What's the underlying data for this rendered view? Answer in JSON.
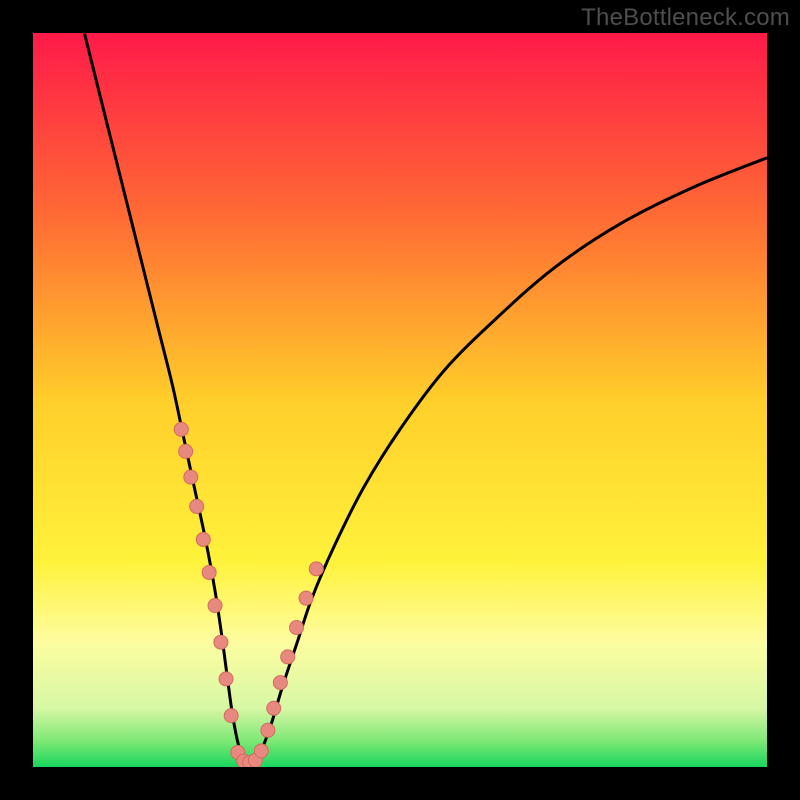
{
  "watermark": "TheBottleneck.com",
  "colors": {
    "black": "#000000",
    "dot_fill": "#e8897f",
    "dot_stroke": "#d46a5f",
    "curve": "#000000"
  },
  "chart_data": {
    "type": "line",
    "title": "",
    "xlabel": "",
    "ylabel": "",
    "xlim": [
      0,
      100
    ],
    "ylim": [
      0,
      100
    ],
    "grid": false,
    "gradient_stops": [
      {
        "offset": 0,
        "color": "#ff1a49"
      },
      {
        "offset": 0.25,
        "color": "#ff6b34"
      },
      {
        "offset": 0.5,
        "color": "#ffce2a"
      },
      {
        "offset": 0.72,
        "color": "#fff23b"
      },
      {
        "offset": 0.83,
        "color": "#fdfda0"
      },
      {
        "offset": 0.92,
        "color": "#d7f7a5"
      },
      {
        "offset": 0.965,
        "color": "#7de874"
      },
      {
        "offset": 1.0,
        "color": "#17d65e"
      }
    ],
    "series": [
      {
        "name": "bottleneck-curve",
        "x": [
          7,
          9,
          11,
          13,
          15,
          17,
          19,
          20.5,
          22,
          23.5,
          24.8,
          25.7,
          26.5,
          27.2,
          28,
          29,
          30,
          31,
          32.5,
          34,
          36,
          38,
          41,
          45,
          50,
          56,
          63,
          71,
          80,
          90,
          100
        ],
        "y": [
          100,
          92,
          84,
          76,
          68,
          60,
          52,
          45,
          38,
          31,
          24,
          18,
          12,
          7,
          3,
          0.5,
          0.5,
          2,
          6,
          11,
          17,
          23,
          30,
          38,
          46,
          54,
          61,
          68,
          74,
          79,
          83
        ]
      }
    ],
    "points": [
      {
        "name": "left-cluster",
        "x": [
          20.2,
          20.8,
          21.5,
          22.3,
          23.2,
          24.0,
          24.8,
          25.6,
          26.3,
          27.0
        ],
        "y": [
          46,
          43,
          39.5,
          35.5,
          31,
          26.5,
          22,
          17,
          12,
          7
        ]
      },
      {
        "name": "bottom-cluster",
        "x": [
          27.9,
          28.7,
          29.5,
          30.3,
          31.1
        ],
        "y": [
          2.0,
          0.8,
          0.6,
          0.9,
          2.2
        ]
      },
      {
        "name": "right-cluster",
        "x": [
          32.0,
          32.8,
          33.7,
          34.7,
          35.9,
          37.2,
          38.6
        ],
        "y": [
          5,
          8,
          11.5,
          15,
          19,
          23,
          27
        ]
      }
    ],
    "dot_radius_px": 7
  }
}
